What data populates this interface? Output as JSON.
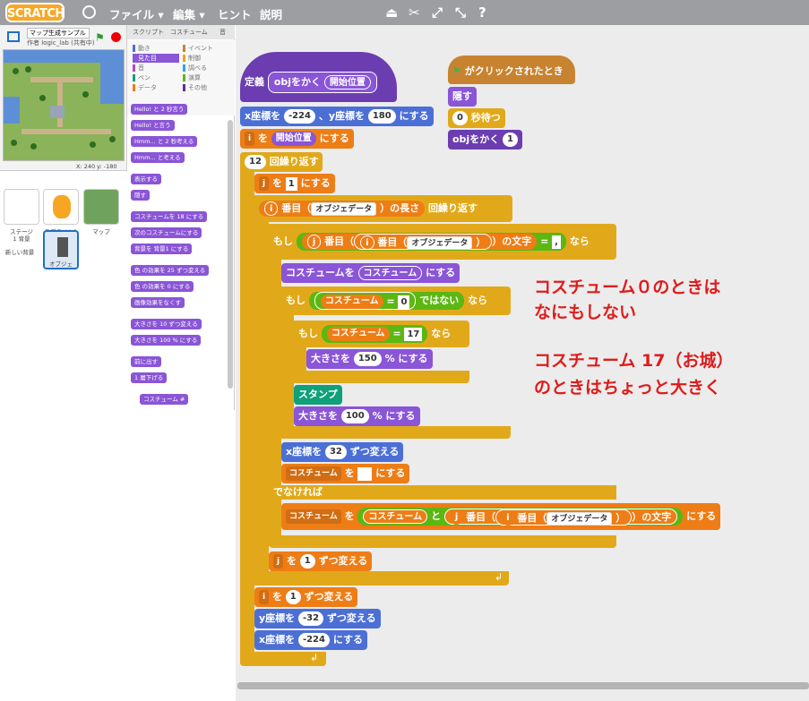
{
  "menu": {
    "logo": "SCRATCH",
    "file": "ファイル ▾",
    "edit": "編集 ▾",
    "hint": "ヒント",
    "help": "説明"
  },
  "project": {
    "name": "マップ生成サンプル",
    "author": "作者 logic_lab (共有中)",
    "coords": "X: 240  y: -180"
  },
  "sprites": {
    "stage": "ステージ",
    "stage_sub": "1 背景",
    "sprite1": "スプライト1",
    "map": "マップ",
    "obj": "オブジェ",
    "new_bg": "新しい背景"
  },
  "tabs": {
    "script": "スクリプト",
    "costume": "コスチューム",
    "sound": "音"
  },
  "categories": [
    "動き",
    "見た目",
    "音",
    "ペン",
    "データ",
    "イベント",
    "制御",
    "調べる",
    "演算",
    "その他"
  ],
  "palette": [
    "Hello! と 2 秒言う",
    "Hello! と言う",
    "Hmm... と 2 秒考える",
    "Hmm... と考える",
    "表示する",
    "隠す",
    "コスチュームを 18 にする",
    "次のコスチュームにする",
    "背景を 背景1 にする",
    "色 の効果を 25 ずつ変える",
    "色 の効果を 0 にする",
    "画像効果をなくす",
    "大きさを 10 ずつ変える",
    "大きさを 100 % にする",
    "前に出す",
    "1 層下げる",
    "コスチューム #"
  ],
  "script": {
    "define": "定義",
    "def_name": "objをかく",
    "def_param": "開始位置",
    "goto_x": "x座標を",
    "goto_y": "、y座標を",
    "set_tail": "にする",
    "x_val": "-224",
    "y_val": "180",
    "var_i": "i",
    "wo": "を",
    "start_pos": "開始位置",
    "repeat_n": "12",
    "repeat": "回繰り返す",
    "var_j": "j",
    "one": "1",
    "item_of": "番目（",
    "obj_data": "オブジェデータ",
    "length": "の長さ",
    "repeat_until": "回繰り返す",
    "if": "もし",
    "char_of": "の文字",
    "eq": "=",
    "comma": ",",
    "then": "なら",
    "costume_set": "コスチュームを",
    "costume": "コスチューム",
    "zero": "0",
    "not": "ではない",
    "seventeen": "17",
    "size_set": "大きさを",
    "size150": "150",
    "size100": "100",
    "pct": "% にする",
    "stamp": "スタンプ",
    "change_x": "x座標を",
    "dx": "32",
    "change_tail": "ずつ変える",
    "costume_dd": "コスチューム",
    "else": "でなければ",
    "join": "と",
    "change_y": "y座標を",
    "dy": "-32",
    "set_x": "x座標を",
    "green_flag": "がクリックされたとき",
    "hide": "隠す",
    "wait_n": "0",
    "wait": "秒待つ",
    "call": "objをかく",
    "call_arg": "1"
  },
  "annotations": {
    "line1": "コスチューム０のときは",
    "line2": "なにもしない",
    "line3": "コスチューム 17（お城）",
    "line4": "のときはちょっと大きく"
  }
}
